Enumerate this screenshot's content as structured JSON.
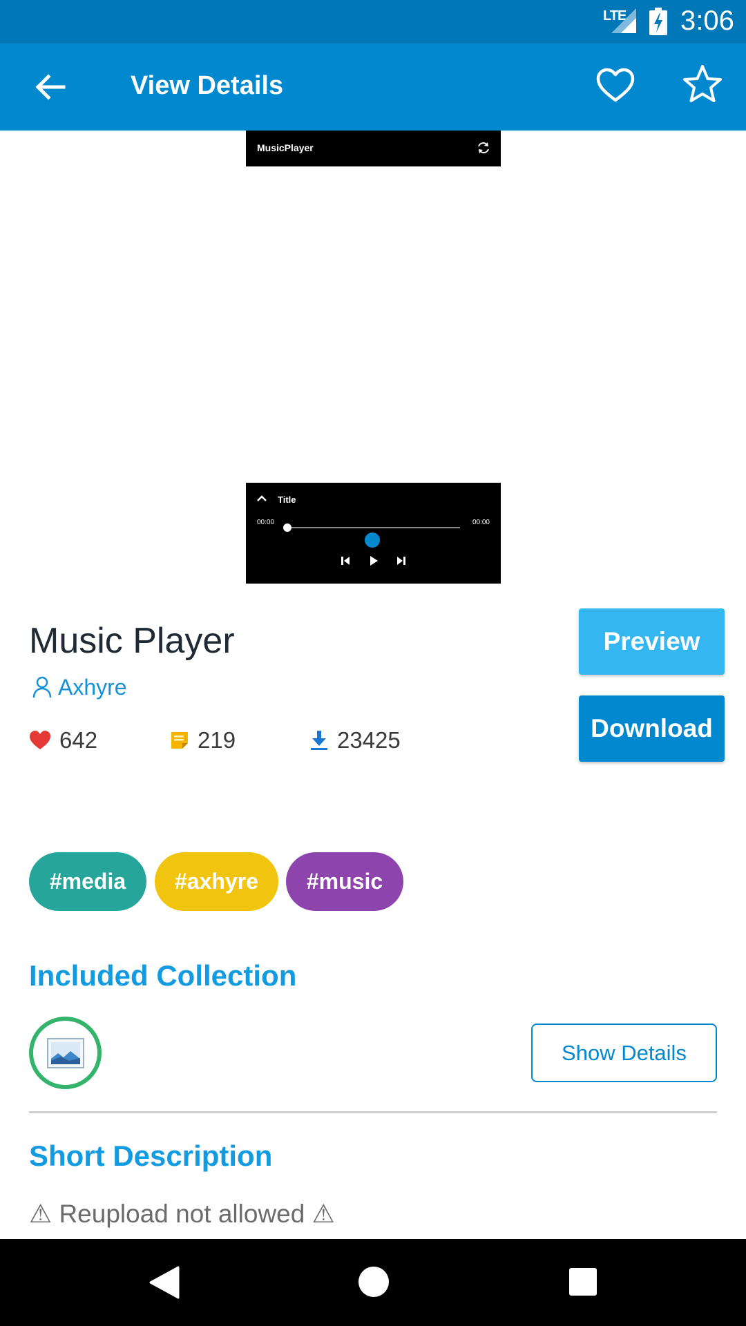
{
  "status_bar": {
    "network": "LTE",
    "time": "3:06"
  },
  "app_bar": {
    "title": "View Details"
  },
  "preview": {
    "header_title": "MusicPlayer",
    "player": {
      "title": "Title",
      "time_start": "00:00",
      "time_end": "00:00"
    }
  },
  "item": {
    "name": "Music Player",
    "author": "Axhyre",
    "stats": {
      "likes": "642",
      "comments": "219",
      "downloads": "23425"
    }
  },
  "buttons": {
    "preview": "Preview",
    "download": "Download"
  },
  "tags": [
    {
      "label": "#media",
      "color": "#26a69a"
    },
    {
      "label": "#axhyre",
      "color": "#f1c40f"
    },
    {
      "label": "#music",
      "color": "#8e44ad"
    }
  ],
  "collection": {
    "heading": "Included Collection",
    "show_details": "Show Details"
  },
  "description": {
    "heading": "Short Description",
    "text": "⚠ Reupload not allowed ⚠"
  },
  "colors": {
    "primary": "#0288cf",
    "status_bar": "#0077b7",
    "accent": "#34b6f0",
    "heading": "#129be0"
  }
}
